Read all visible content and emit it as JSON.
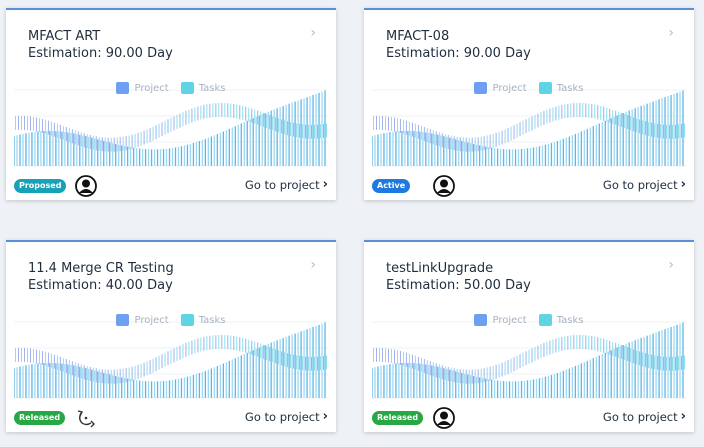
{
  "legend": {
    "project": "Project",
    "tasks": "Tasks"
  },
  "colors": {
    "project": "#6f9ff0",
    "tasks": "#5fd4e4",
    "bars": "#5ab7e8",
    "waves": "#4c74dc"
  },
  "go_to_project": "Go to project",
  "cards": [
    {
      "title": "MFACT ART",
      "estimation": "Estimation: 90.00 Day",
      "status": "Proposed",
      "status_color": "#17a2b8",
      "icon": "user-icon"
    },
    {
      "title": "MFACT-08",
      "estimation": "Estimation: 90.00 Day",
      "status": "Active",
      "status_color": "#1f7ae0",
      "icon": "user-icon"
    },
    {
      "title": "11.4 Merge CR Testing",
      "estimation": "Estimation: 40.00 Day",
      "status": "Released",
      "status_color": "#28a745",
      "icon": "rollback-icon"
    },
    {
      "title": "testLinkUpgrade",
      "estimation": "Estimation: 50.00 Day",
      "status": "Released",
      "status_color": "#28a745",
      "icon": "user-icon"
    }
  ]
}
